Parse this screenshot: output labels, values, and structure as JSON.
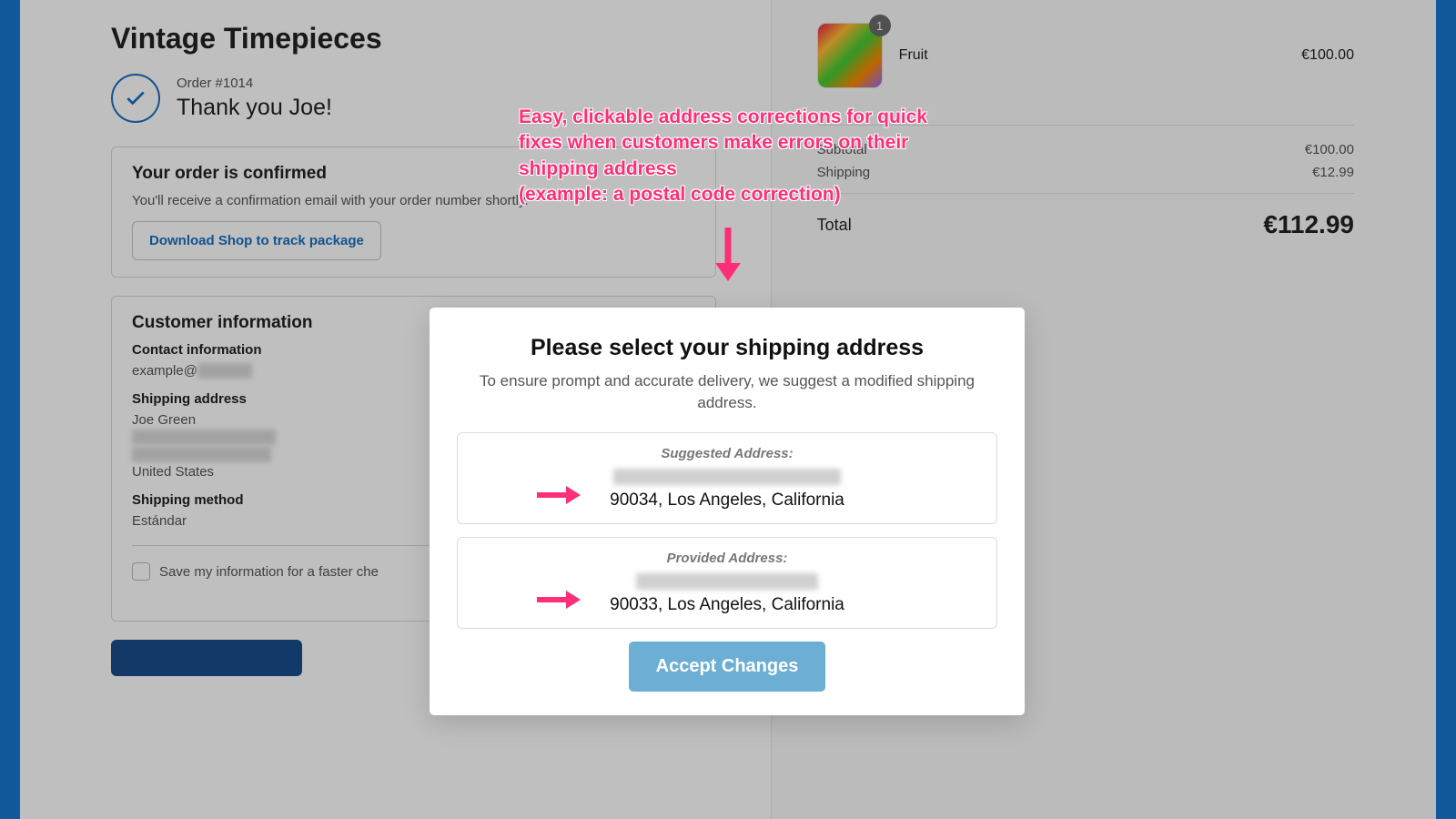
{
  "store": {
    "name": "Vintage Timepieces"
  },
  "order": {
    "number": "Order #1014",
    "thanks": "Thank you Joe!"
  },
  "confirm": {
    "title": "Your order is confirmed",
    "body": "You'll receive a confirmation email with your order number shortly.",
    "download_btn": "Download Shop to track package"
  },
  "customer": {
    "title": "Customer information",
    "contact_label": "Contact information",
    "email_prefix": "example@",
    "shipping_addr_label": "Shipping address",
    "name": "Joe Green",
    "country": "United States",
    "shipping_method_label": "Shipping method",
    "shipping_method_value": "Estándar",
    "save_label": "Save my information for a faster che"
  },
  "cart": {
    "item_name": "Fruit",
    "item_qty": "1",
    "item_price": "€100.00"
  },
  "summary": {
    "subtotal_label": "Subtotal",
    "subtotal_value": "€100.00",
    "shipping_label": "Shipping",
    "shipping_value": "€12.99",
    "total_label": "Total",
    "total_value": "€112.99"
  },
  "annotation": {
    "text": "Easy, clickable address corrections for quick fixes when customers make errors on their shipping address\n(example: a postal code correction)"
  },
  "modal": {
    "title": "Please select your shipping address",
    "subtitle": "To ensure prompt and accurate delivery, we suggest a modified shipping address.",
    "suggested_label": "Suggested Address:",
    "suggested_line2": "90034, Los Angeles, California",
    "provided_label": "Provided Address:",
    "provided_line2": "90033, Los Angeles, California",
    "accept_btn": "Accept Changes"
  }
}
